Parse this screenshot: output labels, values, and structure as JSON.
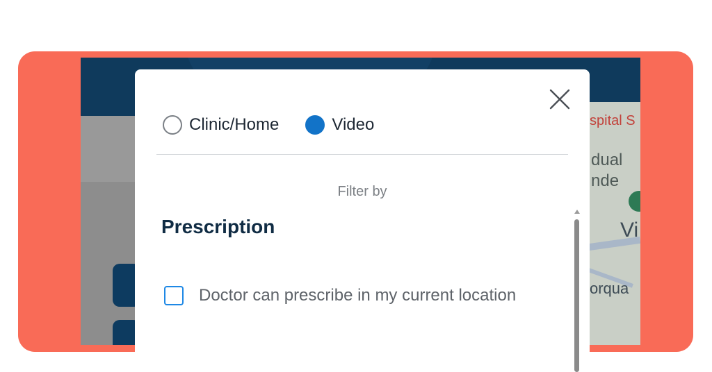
{
  "modal": {
    "delivery_options": [
      {
        "label": "Clinic/Home",
        "checked": false
      },
      {
        "label": "Video",
        "checked": true
      }
    ],
    "filter_by_label": "Filter by",
    "section_title": "Prescription",
    "prescription_option": {
      "label": "Doctor can prescribe in my current location",
      "checked": false
    },
    "close_icon": "close-icon"
  },
  "background_map": {
    "labels": [
      "spital S",
      "dual",
      "nde",
      "Vi",
      "orqua"
    ]
  },
  "colors": {
    "frame": "#f96b57",
    "header": "#0f3a5c",
    "accent": "#1273c8",
    "title": "#102c44"
  }
}
